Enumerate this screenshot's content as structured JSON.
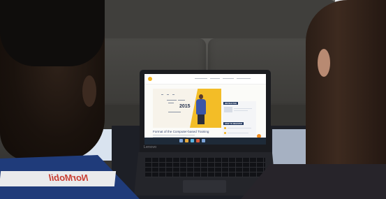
{
  "photo": {
    "description": "",
    "laptop": {
      "brand": "Lenovo",
      "screen": {
        "course_title": "Format of the Computer-based Training",
        "year": "2015",
        "side_labels": [
          "INSTRUCTOR",
          "STEP TO REGISTER"
        ]
      }
    },
    "lanyard_text": "NorMobil"
  },
  "colors": {
    "accent_yellow": "#f3bd27",
    "navy": "#1f355c",
    "presenter_shirt": "#3b56a7"
  }
}
